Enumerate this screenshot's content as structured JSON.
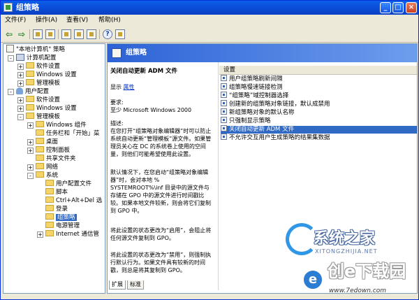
{
  "window": {
    "title": "组策略"
  },
  "menu": [
    "文件(F)",
    "操作(A)",
    "查看(V)",
    "帮助(H)"
  ],
  "tree": [
    {
      "label": "\"本地计算机\" 策略",
      "icon": "policy-icon",
      "expander": ""
    },
    {
      "label": "计算机配置",
      "icon": "computer-icon",
      "expander": "-"
    },
    {
      "label": "软件设置",
      "icon": "folder-icon",
      "expander": "+"
    },
    {
      "label": "Windows 设置",
      "icon": "folder-icon",
      "expander": "+"
    },
    {
      "label": "管理模板",
      "icon": "folder-icon",
      "expander": "+"
    },
    {
      "label": "用户配置",
      "icon": "user-icon",
      "expander": "-"
    },
    {
      "label": "软件设置",
      "icon": "folder-icon",
      "expander": "+"
    },
    {
      "label": "Windows 设置",
      "icon": "folder-icon",
      "expander": "+"
    },
    {
      "label": "管理模板",
      "icon": "folder-icon",
      "expander": "-"
    },
    {
      "label": "Windows 组件",
      "icon": "folder-icon",
      "expander": "+"
    },
    {
      "label": "任务栏和「开始」菜",
      "icon": "folder-icon",
      "expander": ""
    },
    {
      "label": "桌面",
      "icon": "folder-icon",
      "expander": "+"
    },
    {
      "label": "控制面板",
      "icon": "folder-icon",
      "expander": "+"
    },
    {
      "label": "共享文件夹",
      "icon": "folder-icon",
      "expander": ""
    },
    {
      "label": "网络",
      "icon": "folder-icon",
      "expander": "+"
    },
    {
      "label": "系统",
      "icon": "folder-icon",
      "expander": "-"
    },
    {
      "label": "用户配置文件",
      "icon": "folder-icon",
      "expander": ""
    },
    {
      "label": "脚本",
      "icon": "folder-icon",
      "expander": ""
    },
    {
      "label": "Ctrl+Alt+Del 选",
      "icon": "folder-icon",
      "expander": ""
    },
    {
      "label": "登录",
      "icon": "folder-icon",
      "expander": ""
    },
    {
      "label": "组策略",
      "icon": "folder-icon",
      "expander": "",
      "selected": true
    },
    {
      "label": "电源管理",
      "icon": "folder-icon",
      "expander": ""
    },
    {
      "label": "Internet 通信管",
      "icon": "folder-icon",
      "expander": "+"
    }
  ],
  "right": {
    "header": "组策略",
    "setting_title": "关闭自动更新 ADM 文件",
    "show_label": "显示",
    "properties_link": "属性",
    "requirements_label": "要求:",
    "requirements_value": "至少 Microsoft Windows 2000",
    "description_label": "描述:",
    "para1": "在您打开“组策略对象编辑器”时可以防止系统自动更新“管理模板”源文件。如果管理员关心在 DC 的系统卷上使用的空间量，则他们可能希望使用此设置。",
    "para2": "默认情况下，在您启动“组策略对象编辑器”时，会对本地 % SYSTEMROOT%\\inf 目录中的源文件与存储在 GPO 中的源文件进行时间戳比较。如果本地文件较新，则会将它们复制到 GPO 中。",
    "para3": "将此设置的状态更改为“启用”，会阻止将任何源文件复制到 GPO。",
    "para4": "将此设置的状态更改为“禁用”，则强制执行默认行为。如果文件具有较新的时间戳，则总是将其复制到 GPO。",
    "column_header": "设置",
    "settings": [
      "用户组策略刷新间隔",
      "组策略慢速链接检测",
      "“组策略”域控制器选择",
      "创建新的组策略对象链接，默认成禁用",
      "新组策略对象的默认名称",
      "只强制显示策略",
      "关闭自动更新 ADM 文件",
      "不允许交互用户生成策略的结果集数据"
    ],
    "selected_setting_index": 6,
    "tabs": [
      "扩展",
      "标准"
    ]
  },
  "watermarks": {
    "wm1_title": "系统之家",
    "wm1_sub": "XITONGZHIJIA.NET",
    "wm2_title": "创e下载园",
    "wm2_sub": "www.7edown.com",
    "wm2_badge": "e"
  }
}
